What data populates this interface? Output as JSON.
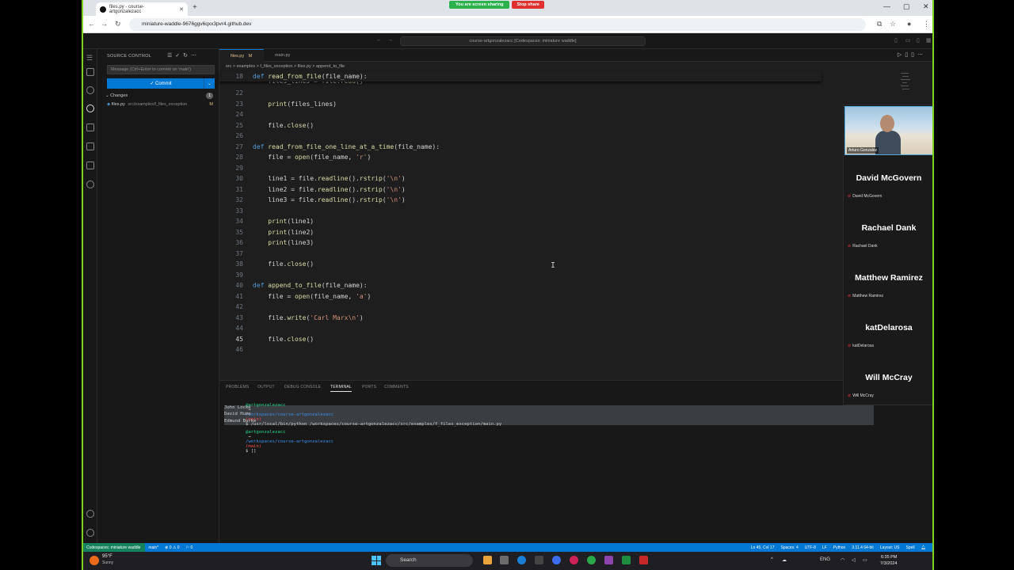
{
  "browser": {
    "tab_title": "files.py - course-artgonzalezacc",
    "url": "miniature-waddle-9676ggv6qxx3pvr4.github.dev",
    "share_status": "You are screen sharing",
    "stop_share": "Stop share"
  },
  "vscode": {
    "command_center": "course-artgonzalezacc [Codespaces: miniature waddle]",
    "sidebar": {
      "title": "SOURCE CONTROL",
      "commit_placeholder": "Message (Ctrl+Enter to commit on 'main')",
      "commit_button": "✓ Commit",
      "changes_label": "Changes",
      "changes_count": "1",
      "changed_file": "files.py",
      "changed_path": "src/examples/f_files_exception",
      "changed_status": "M"
    },
    "tabs": [
      {
        "label": "files.py",
        "status": "M"
      },
      {
        "label": "main.py"
      }
    ],
    "breadcrumb": "src > examples > f_files_exception > files.py > append_to_file",
    "code": {
      "sticky": {
        "num": "18",
        "text": "def read_from_file(file_name):"
      },
      "partial": "    files_lines = file.read()",
      "lines": [
        {
          "num": "22",
          "text": ""
        },
        {
          "num": "23",
          "text": "    print(files_lines)"
        },
        {
          "num": "24",
          "text": ""
        },
        {
          "num": "25",
          "text": "    file.close()"
        },
        {
          "num": "26",
          "text": ""
        },
        {
          "num": "27",
          "text": "def read_from_file_one_line_at_a_time(file_name):"
        },
        {
          "num": "28",
          "text": "    file = open(file_name, 'r')"
        },
        {
          "num": "29",
          "text": ""
        },
        {
          "num": "30",
          "text": "    line1 = file.readline().rstrip('\\n')"
        },
        {
          "num": "31",
          "text": "    line2 = file.readline().rstrip('\\n')"
        },
        {
          "num": "32",
          "text": "    line3 = file.readline().rstrip('\\n')"
        },
        {
          "num": "33",
          "text": ""
        },
        {
          "num": "34",
          "text": "    print(line1)"
        },
        {
          "num": "35",
          "text": "    print(line2)"
        },
        {
          "num": "36",
          "text": "    print(line3)"
        },
        {
          "num": "37",
          "text": ""
        },
        {
          "num": "38",
          "text": "    file.close()"
        },
        {
          "num": "39",
          "text": ""
        },
        {
          "num": "40",
          "text": "def append_to_file(file_name):"
        },
        {
          "num": "41",
          "text": "    file = open(file_name, 'a')"
        },
        {
          "num": "42",
          "text": ""
        },
        {
          "num": "43",
          "text": "    file.write('Carl Marx\\n')"
        },
        {
          "num": "44",
          "text": ""
        },
        {
          "num": "45",
          "text": "    file.close()"
        },
        {
          "num": "46",
          "text": ""
        }
      ],
      "current_line": "45"
    },
    "panel": {
      "tabs": [
        "PROBLEMS",
        "OUTPUT",
        "DEBUG CONSOLE",
        "TERMINAL",
        "PORTS",
        "COMMENTS"
      ],
      "active_tab": "TERMINAL",
      "terminal": {
        "user": "@artgonzalezacc",
        "path": "/workspaces/course-artgonzalezacc",
        "branch": "(main)",
        "command": "$ /usr/local/bin/python /workspaces/course-artgonzalezacc/src/examples/f_files_exception/main.py",
        "output": [
          "John Locke",
          "David Hume",
          "Edmund Burke"
        ],
        "prompt_end": "$ []"
      }
    },
    "statusbar": {
      "remote": "Codespaces: miniature waddle",
      "branch": "main*",
      "errors": "⊗ 0 ⚠ 0",
      "ports": "⚐ 0",
      "position": "Ln 45, Col 17",
      "spaces": "Spaces: 4",
      "encoding": "UTF-8",
      "eol": "LF",
      "language": "Python",
      "interpreter": "3.11.4 64-bit",
      "layout": "Layout: US",
      "spell": "Spell"
    }
  },
  "call": {
    "self_name": "Arturo Gonzalez",
    "participants": [
      "David McGovern",
      "Rachael Dank",
      "Matthew Ramirez",
      "katDelarosa",
      "Will McCray"
    ],
    "partial_label": "Python"
  },
  "taskbar": {
    "temperature": "95°F",
    "weather": "Sunny",
    "search": "Search",
    "lang": "ENG",
    "time": "6:35 PM",
    "date": "7/3/2024"
  },
  "colors": {
    "accent": "#0078d4",
    "remote": "#16825d",
    "border": "#7ed321",
    "keyword": "#569cd6",
    "function": "#dcdcaa",
    "string": "#ce9178"
  }
}
